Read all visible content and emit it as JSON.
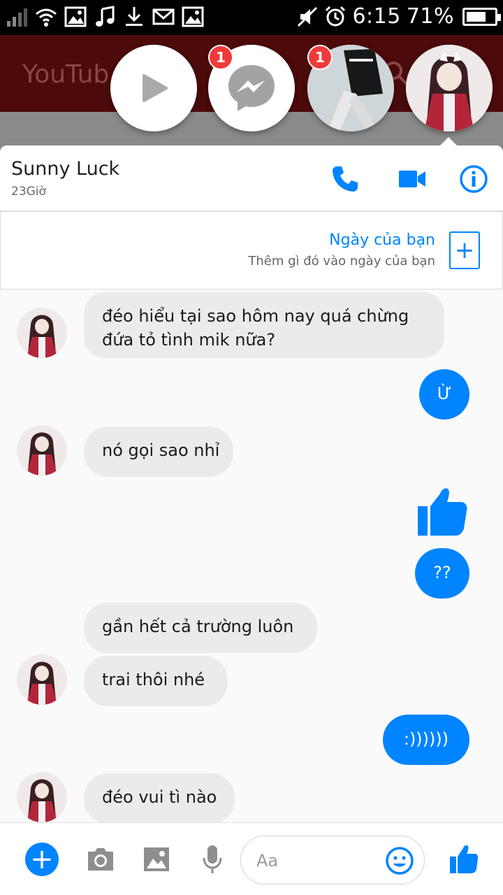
{
  "status_bar": {
    "time": "6:15",
    "battery_percent": "71%",
    "battery_level": 0.71,
    "icons_left": [
      "signal-icon",
      "wifi-icon",
      "gallery-icon",
      "music-icon",
      "download-icon",
      "mail-icon",
      "gallery-icon"
    ],
    "icons_right": [
      "mute-icon",
      "alarm-icon",
      "battery-icon"
    ]
  },
  "background_app": {
    "title": "YouTub"
  },
  "chat_heads": {
    "items": [
      {
        "name": "play-head",
        "badge": ""
      },
      {
        "name": "messenger-head",
        "badge": "1"
      },
      {
        "name": "contact-head-photo",
        "badge": "1"
      },
      {
        "name": "contact-head-anime",
        "badge": ""
      }
    ]
  },
  "header": {
    "contact_name": "Sunny Luck",
    "status": "23Giờ"
  },
  "day_banner": {
    "title": "Ngày của bạn",
    "subtitle": "Thêm gì đó vào ngày của bạn"
  },
  "messages": {
    "m1": {
      "line1": "đéo hiểu tại sao hôm nay quá chừng",
      "line2": "đứa tỏ tình mik nữa?"
    },
    "m2": "Ừ",
    "m3": "nó gọi sao nhỉ",
    "m4": "??",
    "m5": "gần hết cả trường luôn",
    "m6": "trai thôi nhé",
    "m7": ":))))))",
    "m8": "đéo vui tì nào"
  },
  "composer": {
    "placeholder": "Aa"
  },
  "colors": {
    "accent": "#0084ff",
    "incoming_bubble": "#ebebeb",
    "badge": "#f03a3a",
    "youtube_bar": "#4c0a0a"
  }
}
